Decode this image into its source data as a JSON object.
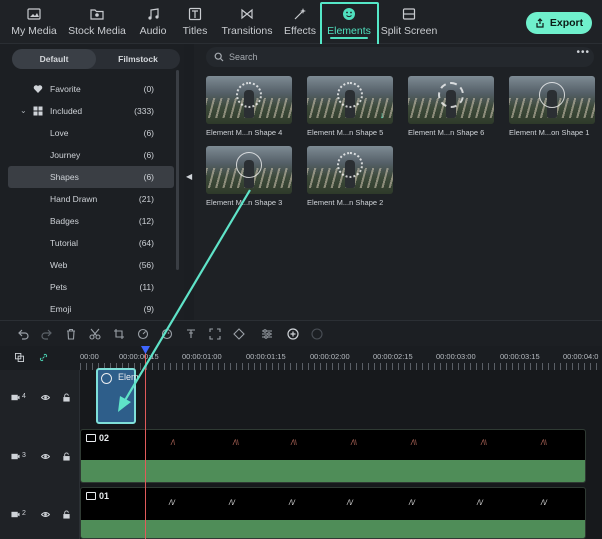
{
  "colors": {
    "accent": "#4fe0be",
    "highlight_box": "#55e8c8",
    "export_bg": "#6ff0cc",
    "annotation_arrow": "#5fe3c8",
    "playhead": "#e05a5a",
    "element_clip": "#2e5e8a",
    "audio_wave": "#4f8d58"
  },
  "topbar": {
    "tabs": [
      {
        "label": "My Media",
        "icon": "image-icon"
      },
      {
        "label": "Stock Media",
        "icon": "folder-icon"
      },
      {
        "label": "Audio",
        "icon": "music-note-icon"
      },
      {
        "label": "Titles",
        "icon": "text-icon"
      },
      {
        "label": "Transitions",
        "icon": "transition-icon"
      },
      {
        "label": "Effects",
        "icon": "sparkle-icon"
      },
      {
        "label": "Elements",
        "icon": "smiley-icon",
        "active": true
      },
      {
        "label": "Split Screen",
        "icon": "split-screen-icon"
      }
    ],
    "export_label": "Export"
  },
  "left_panel": {
    "segment": {
      "default_label": "Default",
      "filmstock_label": "Filmstock"
    },
    "categories": [
      {
        "name": "Favorite",
        "count": "(0)"
      },
      {
        "name": "Included",
        "count": "(333)"
      },
      {
        "name": "Love",
        "count": "(6)"
      },
      {
        "name": "Journey",
        "count": "(6)"
      },
      {
        "name": "Shapes",
        "count": "(6)"
      },
      {
        "name": "Hand Drawn",
        "count": "(21)"
      },
      {
        "name": "Badges",
        "count": "(12)"
      },
      {
        "name": "Tutorial",
        "count": "(64)"
      },
      {
        "name": "Web",
        "count": "(56)"
      },
      {
        "name": "Pets",
        "count": "(11)"
      },
      {
        "name": "Emoji",
        "count": "(9)"
      }
    ]
  },
  "content": {
    "search_placeholder": "Search",
    "thumbnails": [
      {
        "label": "Element M...n Shape 4"
      },
      {
        "label": "Element M...n Shape 5"
      },
      {
        "label": "Element M...n Shape 6"
      },
      {
        "label": "Element M...on Shape 1"
      },
      {
        "label": "Element M...n Shape 3"
      },
      {
        "label": "Element M...n Shape 2"
      }
    ]
  },
  "timeline": {
    "ruler_labels": [
      "00:00",
      "00:00:00:15",
      "00:00:01:00",
      "00:00:01:15",
      "00:00:02:00",
      "00:00:02:15",
      "00:00:03:00",
      "00:00:03:15",
      "00:00:04:0"
    ],
    "tracks": [
      {
        "number": "4",
        "clip_title": "Elem"
      },
      {
        "number": "3",
        "clip_title": "02"
      },
      {
        "number": "2",
        "clip_title": "01"
      }
    ]
  }
}
